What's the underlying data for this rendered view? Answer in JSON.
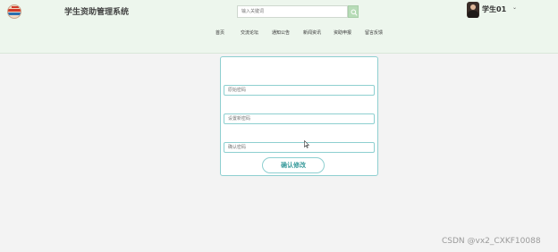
{
  "header": {
    "site_title": "学生资助管理系统",
    "search_placeholder": "输入关键词",
    "user_name": "学生01",
    "user_caret": "⌄"
  },
  "nav": {
    "items": [
      {
        "label": "首页"
      },
      {
        "label": "交流论坛"
      },
      {
        "label": "通知公告"
      },
      {
        "label": "新闻资讯"
      },
      {
        "label": "资助申报"
      },
      {
        "label": "留言反馈"
      }
    ]
  },
  "form": {
    "old_password_placeholder": "原始密码",
    "new_password_placeholder": "设置新密码",
    "confirm_password_placeholder": "确认密码",
    "submit_label": "确认修改"
  },
  "watermark": "CSDN @vx2_CXKF10088",
  "colors": {
    "header_bg": "#edf6ed",
    "accent": "#8ecfd0",
    "button_text": "#3a9b9c"
  }
}
